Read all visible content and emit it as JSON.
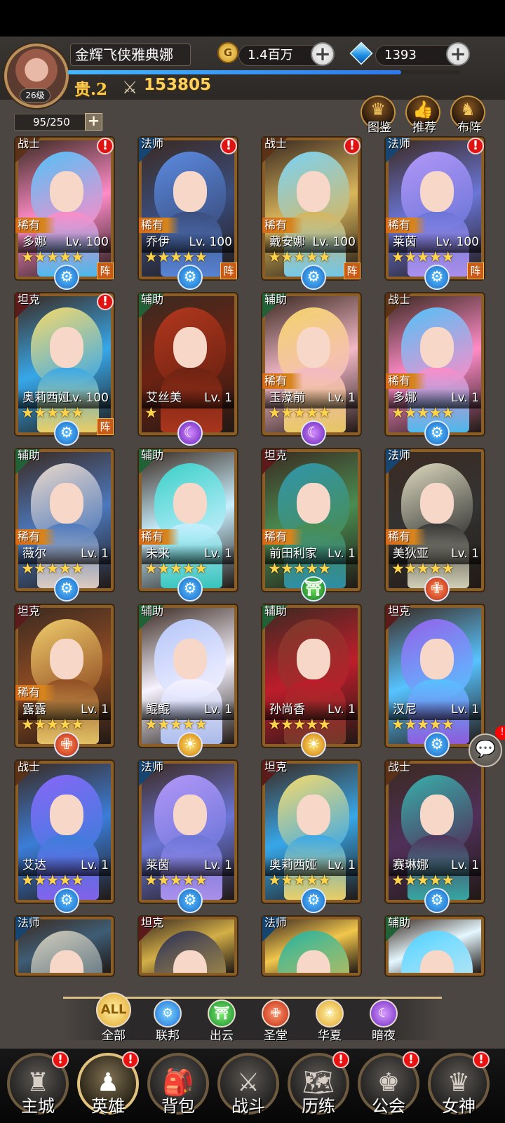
{
  "player": {
    "name": "金辉飞侠雅典娜",
    "level_label": "26级",
    "gold": "1.4百万",
    "gems": "1393",
    "vip": "贵.2",
    "power": "153805",
    "exp_progress": 0.85,
    "capacity": "95/250"
  },
  "icons": {
    "coin": "G",
    "plus": "+",
    "sword": "⚔",
    "alert": "!",
    "star": "★"
  },
  "actions": [
    {
      "name": "collection",
      "label": "图鉴",
      "icon": "♛"
    },
    {
      "name": "recommend",
      "label": "推荐",
      "icon": "👍"
    },
    {
      "name": "formation",
      "label": "布阵",
      "icon": "♞"
    }
  ],
  "heroes": [
    {
      "role": "战士",
      "name": "多娜",
      "level": "Lv. 100",
      "rare": "稀有",
      "alert": "!",
      "faction": "⚙",
      "stars": "★★★★★",
      "formation": "阵",
      "colors": [
        "#4fc7ff",
        "#ff8bc7"
      ]
    },
    {
      "role": "法师",
      "name": "乔伊",
      "level": "Lv. 100",
      "rare": "稀有",
      "alert": "!",
      "faction": "⚙",
      "stars": "★★★★★",
      "formation": "阵",
      "colors": [
        "#5d8fe8",
        "#3a4d7d"
      ]
    },
    {
      "role": "战士",
      "name": "戴安娜",
      "level": "Lv. 100",
      "rare": "稀有",
      "alert": "!",
      "faction": "⚙",
      "stars": "★★★★★",
      "formation": "阵",
      "colors": [
        "#7ad8ff",
        "#d9b55b"
      ]
    },
    {
      "role": "法师",
      "name": "莱茵",
      "level": "Lv. 100",
      "rare": "稀有",
      "alert": "!",
      "faction": "⚙",
      "stars": "★★★★★",
      "formation": "阵",
      "colors": [
        "#b79bff",
        "#6a75d6"
      ]
    },
    {
      "role": "坦克",
      "name": "奥莉西娅",
      "level": "Lv. 100",
      "rare": "",
      "alert": "!",
      "faction": "⚙",
      "stars": "★★★★★",
      "formation": "阵",
      "colors": [
        "#ffe06c",
        "#37a7e9"
      ]
    },
    {
      "role": "辅助",
      "name": "艾丝美",
      "level": "Lv. 1",
      "rare": "",
      "alert": "",
      "faction": "☾",
      "stars": "★",
      "formation": "",
      "colors": [
        "#b7381e",
        "#6c2212"
      ]
    },
    {
      "role": "辅助",
      "name": "玉藻前",
      "level": "Lv. 1",
      "rare": "稀有",
      "alert": "",
      "faction": "☾",
      "stars": "★★★★★",
      "formation": "",
      "colors": [
        "#f9d86b",
        "#f3b8c7"
      ]
    },
    {
      "role": "战士",
      "name": "多娜",
      "level": "Lv. 1",
      "rare": "稀有",
      "alert": "",
      "faction": "⚙",
      "stars": "★★★★★",
      "formation": "",
      "colors": [
        "#4fc7ff",
        "#ff8bc7"
      ]
    },
    {
      "role": "辅助",
      "name": "薇尔",
      "level": "Lv. 1",
      "rare": "稀有",
      "alert": "",
      "faction": "⚙",
      "stars": "★★★★★",
      "formation": "",
      "colors": [
        "#f0ded0",
        "#4c78bc"
      ]
    },
    {
      "role": "辅助",
      "name": "未来",
      "level": "Lv. 1",
      "rare": "稀有",
      "alert": "",
      "faction": "⚙",
      "stars": "★★★★★",
      "formation": "",
      "colors": [
        "#38d4cc",
        "#c8f0ff"
      ]
    },
    {
      "role": "坦克",
      "name": "前田利家",
      "level": "Lv. 1",
      "rare": "稀有",
      "alert": "",
      "faction": "⛩",
      "stars": "★★★★★",
      "formation": "",
      "colors": [
        "#2f99b2",
        "#4a8c51"
      ]
    },
    {
      "role": "法师",
      "name": "美狄亚",
      "level": "Lv. 1",
      "rare": "稀有",
      "alert": "",
      "faction": "✙",
      "stars": "★★★★★",
      "formation": "",
      "colors": [
        "#e4e2c6",
        "#333"
      ]
    },
    {
      "role": "坦克",
      "name": "露露",
      "level": "Lv. 1",
      "rare": "稀有",
      "alert": "",
      "faction": "✙",
      "stars": "★★★★★",
      "formation": "",
      "colors": [
        "#f7d46f",
        "#8f4b22"
      ]
    },
    {
      "role": "辅助",
      "name": "鲲鲲",
      "level": "Lv. 1",
      "rare": "",
      "alert": "",
      "faction": "☀",
      "stars": "★★★★★",
      "formation": "",
      "colors": [
        "#b6c9ff",
        "#f6f3ff"
      ]
    },
    {
      "role": "辅助",
      "name": "孙尚香",
      "level": "Lv. 1",
      "rare": "",
      "alert": "",
      "faction": "☀",
      "stars": "★★★★★",
      "formation": "",
      "colors": [
        "#7b3c2b",
        "#bd1d2b"
      ]
    },
    {
      "role": "坦克",
      "name": "汉尼",
      "level": "Lv. 1",
      "rare": "",
      "alert": "",
      "faction": "⚙",
      "stars": "★★★★★",
      "formation": "",
      "colors": [
        "#9861ef",
        "#57c3ff"
      ]
    },
    {
      "role": "战士",
      "name": "艾达",
      "level": "Lv. 1",
      "rare": "",
      "alert": "",
      "faction": "⚙",
      "stars": "★★★★★",
      "formation": "",
      "colors": [
        "#8c68ff",
        "#3b7dd8"
      ]
    },
    {
      "role": "法师",
      "name": "莱茵",
      "level": "Lv. 1",
      "rare": "",
      "alert": "",
      "faction": "⚙",
      "stars": "★★★★★",
      "formation": "",
      "colors": [
        "#b79bff",
        "#6a75d6"
      ]
    },
    {
      "role": "坦克",
      "name": "奥莉西娅",
      "level": "Lv. 1",
      "rare": "",
      "alert": "",
      "faction": "⚙",
      "stars": "★★★★★",
      "formation": "",
      "colors": [
        "#ffe06c",
        "#37a7e9"
      ]
    },
    {
      "role": "战士",
      "name": "赛琳娜",
      "level": "Lv. 1",
      "rare": "",
      "alert": "",
      "faction": "⚙",
      "stars": "★★★★★",
      "formation": "",
      "colors": [
        "#38b5b0",
        "#503059"
      ]
    },
    {
      "role": "法师",
      "name": "",
      "level": "",
      "rare": "",
      "alert": "",
      "faction": "",
      "stars": "",
      "formation": "",
      "colors": [
        "#d9d3c0",
        "#3e5d75"
      ]
    },
    {
      "role": "坦克",
      "name": "",
      "level": "",
      "rare": "",
      "alert": "",
      "faction": "",
      "stars": "",
      "formation": "",
      "colors": [
        "#252b57",
        "#d3af47"
      ]
    },
    {
      "role": "法师",
      "name": "",
      "level": "",
      "rare": "",
      "alert": "",
      "faction": "",
      "stars": "",
      "formation": "",
      "colors": [
        "#1bb3a5",
        "#f2c74c"
      ]
    },
    {
      "role": "辅助",
      "name": "",
      "level": "",
      "rare": "",
      "alert": "",
      "faction": "",
      "stars": "",
      "formation": "",
      "colors": [
        "#49cfff",
        "#e5f8ff"
      ]
    }
  ],
  "filters": [
    {
      "label": "全部",
      "icon": "ALL",
      "color": "gold"
    },
    {
      "label": "联邦",
      "icon": "⚙",
      "color": "blue"
    },
    {
      "label": "出云",
      "icon": "⛩",
      "color": "green"
    },
    {
      "label": "圣堂",
      "icon": "✙",
      "color": "red"
    },
    {
      "label": "华夏",
      "icon": "☀",
      "color": "gold"
    },
    {
      "label": "暗夜",
      "icon": "☾",
      "color": "purple"
    }
  ],
  "chat": {
    "icon": "💬",
    "alert": "!"
  },
  "nav": [
    {
      "label": "主城",
      "icon": "♜",
      "alert": "!"
    },
    {
      "label": "英雄",
      "icon": "♟",
      "alert": "!"
    },
    {
      "label": "背包",
      "icon": "🎒",
      "alert": ""
    },
    {
      "label": "战斗",
      "icon": "⚔",
      "alert": ""
    },
    {
      "label": "历练",
      "icon": "🗺",
      "alert": "!"
    },
    {
      "label": "公会",
      "icon": "♚",
      "alert": "!"
    },
    {
      "label": "女神",
      "icon": "♛",
      "alert": "!"
    }
  ]
}
